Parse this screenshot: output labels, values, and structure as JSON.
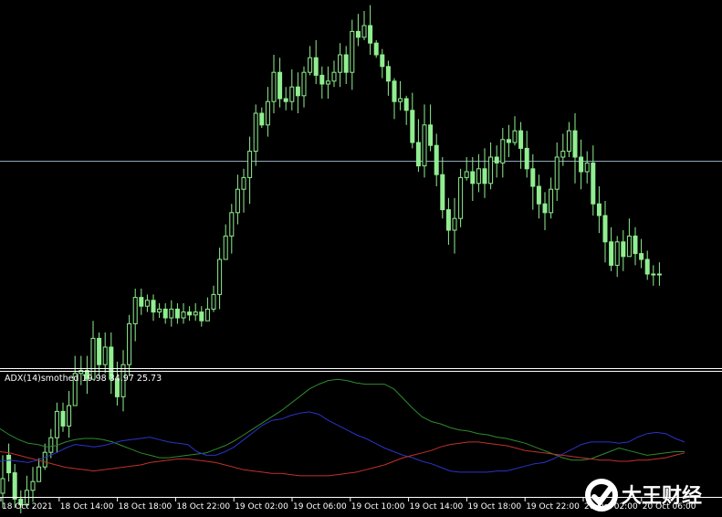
{
  "colors": {
    "background": "#000000",
    "candle": "#90EE90",
    "price_line": "#8FA6B8",
    "adx": "#2E8B2E",
    "plus_di": "#2A33C8",
    "minus_di": "#C0312B",
    "separator": "#FFFFFF",
    "axis_text": "#FFFFFF"
  },
  "chart_data": [
    {
      "type": "candlestick",
      "name": "price",
      "grid": false,
      "horizontal_line": true,
      "candles": [
        [
          75,
          70,
          62,
          80
        ],
        [
          62,
          68,
          58,
          71
        ],
        [
          68,
          77,
          65,
          80
        ],
        [
          77,
          79,
          74,
          84
        ],
        [
          79,
          74,
          69,
          80
        ],
        [
          74,
          71,
          66,
          78
        ],
        [
          71,
          66,
          63,
          69
        ],
        [
          66,
          61,
          58,
          67
        ],
        [
          61,
          56,
          53,
          63
        ],
        [
          56,
          47,
          44,
          61
        ],
        [
          47,
          52,
          44,
          54
        ],
        [
          52,
          45,
          40,
          56
        ],
        [
          45,
          34,
          28,
          41
        ],
        [
          34,
          33,
          28,
          38
        ],
        [
          33,
          36,
          28,
          41
        ],
        [
          36,
          22,
          16,
          26
        ],
        [
          22,
          31,
          20,
          35
        ],
        [
          31,
          25,
          20,
          34
        ],
        [
          25,
          36,
          20,
          41
        ],
        [
          36,
          42,
          30,
          45
        ],
        [
          42,
          31,
          26,
          47
        ],
        [
          31,
          17,
          14,
          35
        ],
        [
          17,
          8,
          5,
          23
        ],
        [
          8,
          11,
          5,
          14
        ],
        [
          11,
          9,
          7,
          13
        ],
        [
          9,
          13,
          7,
          16
        ],
        [
          13,
          12,
          10,
          15
        ],
        [
          12,
          15,
          10,
          17
        ],
        [
          15,
          12,
          9,
          18
        ],
        [
          12,
          15,
          10,
          17
        ],
        [
          15,
          13,
          10,
          17
        ],
        [
          13,
          14,
          11,
          16
        ],
        [
          14,
          13,
          10,
          16
        ],
        [
          13,
          16,
          11,
          18
        ],
        [
          16,
          12,
          8,
          16
        ],
        [
          12,
          7,
          4,
          13
        ],
        [
          7,
          -5,
          -9,
          12
        ],
        [
          -5,
          -13,
          -17,
          -10
        ],
        [
          -13,
          -21,
          -24,
          -7
        ],
        [
          -21,
          -29,
          -34,
          -17
        ],
        [
          -29,
          -33,
          -36,
          -21
        ],
        [
          -33,
          -42,
          -47,
          -24
        ],
        [
          -42,
          -55,
          -58,
          -37
        ],
        [
          -55,
          -51,
          -57,
          -50
        ],
        [
          -51,
          -59,
          -64,
          -47
        ],
        [
          -59,
          -69,
          -75,
          -55
        ],
        [
          -69,
          -60,
          -74,
          -57
        ],
        [
          -60,
          -59,
          -64,
          -56
        ],
        [
          -59,
          -64,
          -70,
          -56
        ],
        [
          -64,
          -61,
          -69,
          -55
        ],
        [
          -61,
          -69,
          -71,
          -57
        ],
        [
          -69,
          -74,
          -78,
          -68
        ],
        [
          -74,
          -68,
          -80,
          -65
        ],
        [
          -68,
          -65,
          -71,
          -60
        ],
        [
          -65,
          -66,
          -71,
          -60
        ],
        [
          -66,
          -69,
          -73,
          -64
        ],
        [
          -69,
          -75,
          -79,
          -64
        ],
        [
          -75,
          -69,
          -78,
          -65
        ],
        [
          -69,
          -83,
          -87,
          -63
        ],
        [
          -83,
          -81,
          -89,
          -78
        ],
        [
          -81,
          -85,
          -90,
          -80
        ],
        [
          -85,
          -79,
          -92,
          -75
        ],
        [
          -79,
          -75,
          -80,
          -74
        ],
        [
          -75,
          -71,
          -77,
          -67
        ],
        [
          -71,
          -66,
          -73,
          -61
        ],
        [
          -66,
          -59,
          -67,
          -53
        ],
        [
          -59,
          -60,
          -66,
          -56
        ],
        [
          -60,
          -56,
          -61,
          -51
        ],
        [
          -56,
          -45,
          -62,
          -43
        ],
        [
          -45,
          -37,
          -53,
          -35
        ],
        [
          -37,
          -51,
          -58,
          -33
        ],
        [
          -51,
          -44,
          -58,
          -42
        ],
        [
          -44,
          -34,
          -48,
          -30
        ],
        [
          -34,
          -22,
          -40,
          -19
        ],
        [
          -22,
          -15,
          -26,
          -10
        ],
        [
          -15,
          -19,
          -26,
          -7
        ],
        [
          -19,
          -33,
          -36,
          -16
        ],
        [
          -33,
          -35,
          -40,
          -32
        ],
        [
          -35,
          -31,
          -40,
          -25
        ],
        [
          -31,
          -36,
          -41,
          -28
        ],
        [
          -36,
          -31,
          -43,
          -26
        ],
        [
          -31,
          -40,
          -45,
          -29
        ],
        [
          -40,
          -38,
          -44,
          -33
        ],
        [
          -38,
          -46,
          -50,
          -33
        ],
        [
          -46,
          -45,
          -51,
          -40
        ],
        [
          -45,
          -49,
          -54,
          -44
        ],
        [
          -49,
          -43,
          -52,
          -36
        ],
        [
          -43,
          -36,
          -49,
          -33
        ],
        [
          -36,
          -30,
          -41,
          -22
        ],
        [
          -30,
          -24,
          -34,
          -19
        ],
        [
          -24,
          -21,
          -28,
          -15
        ],
        [
          -21,
          -29,
          -33,
          -19
        ],
        [
          -29,
          -40,
          -45,
          -25
        ],
        [
          -40,
          -42,
          -48,
          -37
        ],
        [
          -42,
          -49,
          -52,
          -40
        ],
        [
          -49,
          -40,
          -55,
          -31
        ],
        [
          -40,
          -35,
          -46,
          -29
        ],
        [
          -35,
          -38,
          -42,
          -31
        ],
        [
          -38,
          -24,
          -44,
          -20
        ],
        [
          -24,
          -20,
          -30,
          -14
        ],
        [
          -20,
          -11,
          -25,
          -4
        ],
        [
          -11,
          -3,
          -16,
          -1
        ],
        [
          -3,
          -11,
          -13,
          1
        ],
        [
          -11,
          -6,
          -15,
          -1
        ],
        [
          -6,
          -13,
          -19,
          -8
        ],
        [
          -13,
          -7,
          -16,
          -3
        ],
        [
          -7,
          -5,
          -12,
          -2
        ],
        [
          -5,
          0,
          -8,
          2
        ],
        [
          0,
          0,
          -3,
          4
        ],
        [
          0,
          0,
          -4,
          4
        ]
      ]
    },
    {
      "type": "line",
      "name": "ADX(14)smothed",
      "title": "ADX(14)smothed 19.98 34.97 25.73",
      "grid": false,
      "x": [
        "18 Oct 2021",
        "18 Oct 14:00",
        "18 Oct 18:00",
        "18 Oct 22:00",
        "19 Oct 02:00",
        "19 Oct 06:00",
        "19 Oct 10:00",
        "19 Oct 14:00",
        "19 Oct 18:00",
        "19 Oct 22:00",
        "20 Oct 02:00",
        "20 Oct 06:00"
      ],
      "series": [
        {
          "values": [
            55,
            50,
            46,
            43,
            42,
            40,
            41,
            44,
            46,
            47,
            47,
            46,
            44,
            41,
            38,
            35,
            33,
            31,
            31,
            32,
            33,
            34,
            35,
            38,
            41,
            45,
            50,
            55,
            60,
            65,
            70,
            76,
            82,
            88,
            92,
            95,
            96,
            95,
            93,
            92,
            92,
            92,
            88,
            80,
            72,
            65,
            61,
            59,
            56,
            54,
            53,
            51,
            50,
            48,
            47,
            45,
            43,
            40,
            37,
            34,
            31,
            29,
            29,
            30,
            33,
            36,
            39,
            37,
            35,
            33,
            34,
            35,
            36,
            36
          ]
        },
        {
          "values": [
            28,
            29,
            28,
            27,
            29,
            32,
            35,
            39,
            42,
            41,
            40,
            41,
            43,
            45,
            46,
            47,
            48,
            46,
            44,
            43,
            42,
            36,
            33,
            33,
            36,
            40,
            46,
            52,
            58,
            62,
            63,
            66,
            68,
            69,
            67,
            62,
            58,
            54,
            50,
            47,
            43,
            39,
            36,
            33,
            31,
            28,
            26,
            23,
            20,
            19,
            19,
            19,
            19,
            20,
            20,
            22,
            24,
            26,
            27,
            30,
            34,
            38,
            42,
            44,
            44,
            44,
            43,
            44,
            48,
            51,
            52,
            51,
            47,
            44
          ]
        },
        {
          "values": [
            36,
            35,
            33,
            31,
            29,
            27,
            25,
            23,
            22,
            21,
            20,
            21,
            22,
            23,
            24,
            25,
            27,
            28,
            29,
            30,
            30,
            29,
            28,
            27,
            25,
            23,
            21,
            20,
            19,
            18,
            18,
            17,
            16,
            16,
            16,
            16,
            17,
            18,
            19,
            21,
            23,
            25,
            28,
            31,
            33,
            35,
            37,
            40,
            42,
            43,
            44,
            44,
            43,
            42,
            41,
            39,
            37,
            36,
            35,
            34,
            33,
            32,
            31,
            30,
            29,
            29,
            28,
            28,
            29,
            29,
            30,
            31,
            33,
            35
          ]
        }
      ],
      "ylim": [
        0,
        100
      ]
    }
  ]
}
